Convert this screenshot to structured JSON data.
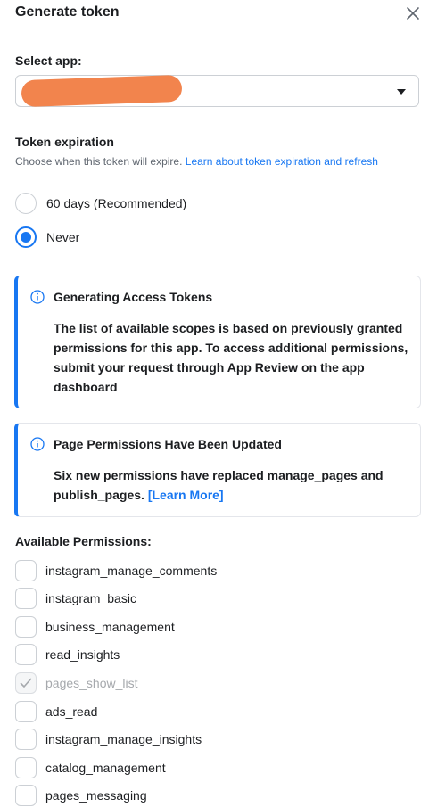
{
  "dialog": {
    "title": "Generate token",
    "close_icon": "close-icon"
  },
  "select_app": {
    "label": "Select app:",
    "value": ""
  },
  "expiration": {
    "heading": "Token expiration",
    "help_text": "Choose when this token will expire. ",
    "help_link": "Learn about token expiration and refresh",
    "options": [
      {
        "label": "60 days (Recommended)",
        "selected": false
      },
      {
        "label": "Never",
        "selected": true
      }
    ]
  },
  "notice1": {
    "title": "Generating Access Tokens",
    "body": "The list of available scopes is based on previously granted permissions for this app. To access additional permissions, submit your request through App Review on the app dashboard"
  },
  "notice2": {
    "title": "Page Permissions Have Been Updated",
    "body": "Six new permissions have replaced manage_pages and publish_pages. ",
    "link": "[Learn More]"
  },
  "permissions": {
    "heading": "Available Permissions:",
    "items": [
      {
        "label": "instagram_manage_comments",
        "checked": false,
        "disabled": false
      },
      {
        "label": "instagram_basic",
        "checked": false,
        "disabled": false
      },
      {
        "label": "business_management",
        "checked": false,
        "disabled": false
      },
      {
        "label": "read_insights",
        "checked": false,
        "disabled": false
      },
      {
        "label": "pages_show_list",
        "checked": true,
        "disabled": true
      },
      {
        "label": "ads_read",
        "checked": false,
        "disabled": false
      },
      {
        "label": "instagram_manage_insights",
        "checked": false,
        "disabled": false
      },
      {
        "label": "catalog_management",
        "checked": false,
        "disabled": false
      },
      {
        "label": "pages_messaging",
        "checked": false,
        "disabled": false
      }
    ]
  },
  "colors": {
    "accent": "#1877f2",
    "text": "#1c1e21",
    "muted": "#606770",
    "redaction": "#f2844d"
  }
}
